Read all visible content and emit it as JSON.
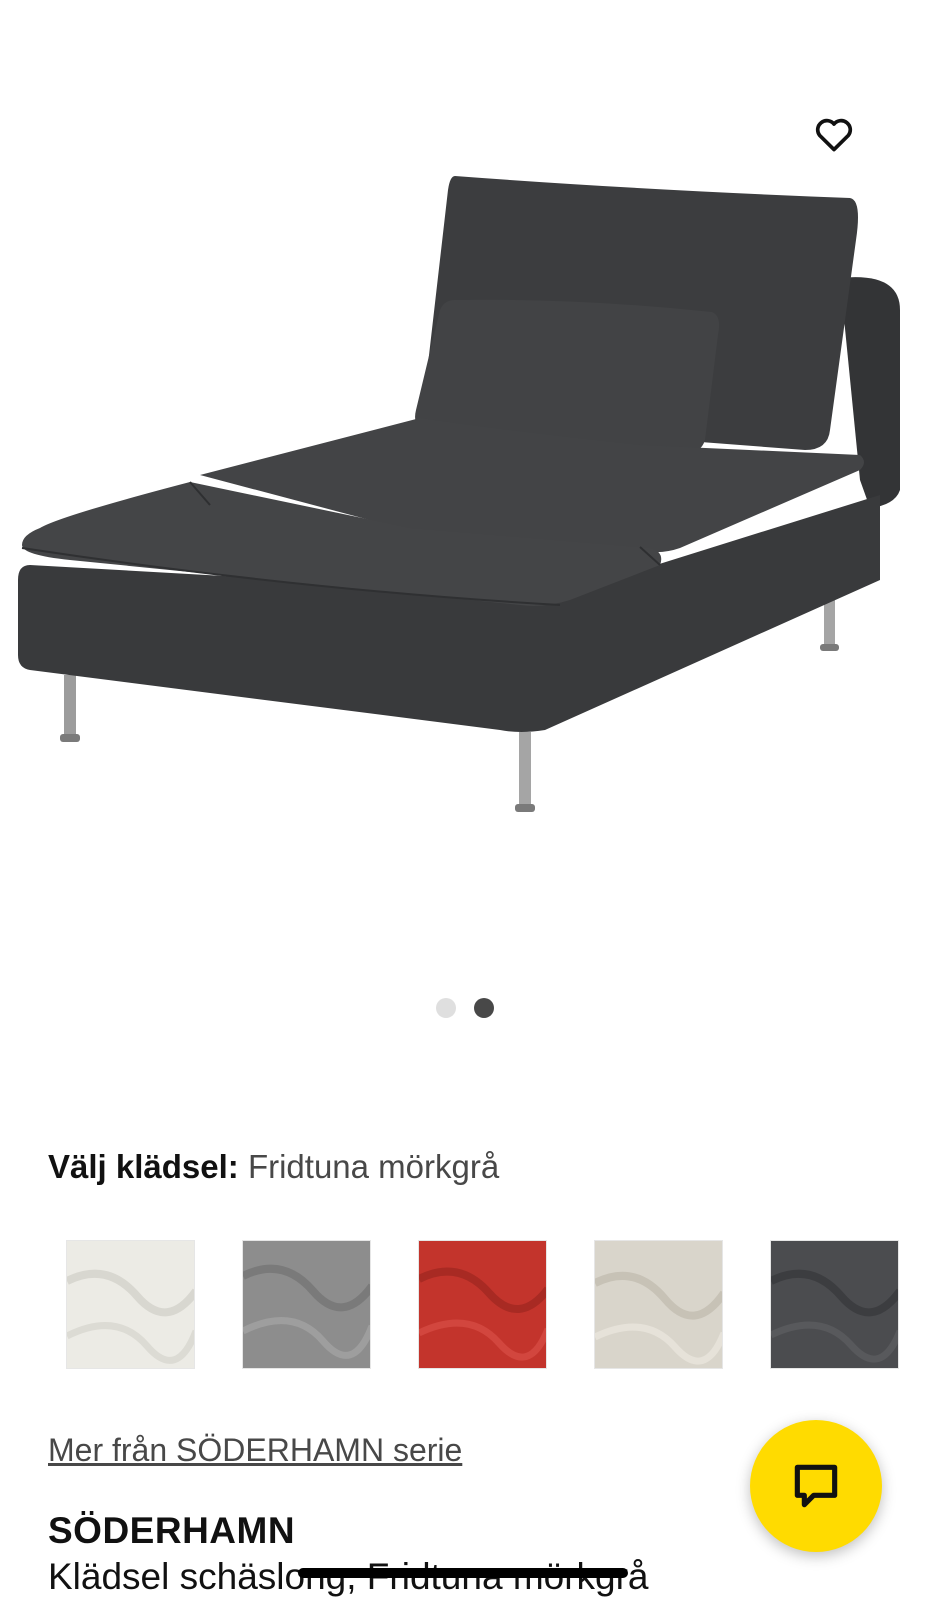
{
  "product": {
    "image_alt": "SÖDERHAMN schäslong",
    "gallery": {
      "total": 2,
      "active": 2
    }
  },
  "fabric": {
    "label": "Välj klädsel:",
    "selected": "Fridtuna mörkgrå",
    "swatches": [
      {
        "name": "vit",
        "color": "#ecebe5"
      },
      {
        "name": "grå",
        "color": "#8d8d8d"
      },
      {
        "name": "röd",
        "color": "#c3342c"
      },
      {
        "name": "beige",
        "color": "#d9d5cb"
      },
      {
        "name": "mörkgrå",
        "color": "#4b4c4f"
      }
    ]
  },
  "series_link": "Mer från SÖDERHAMN serie",
  "title": "SÖDERHAMN",
  "description": "Klädsel schäslong, Fridtuna mörkgrå",
  "colors": {
    "accent_yellow": "#ffdb00",
    "sofa": "#3e3f41"
  },
  "icons": {
    "favorite": "heart-outline-icon",
    "chat": "chat-bubble-icon"
  }
}
